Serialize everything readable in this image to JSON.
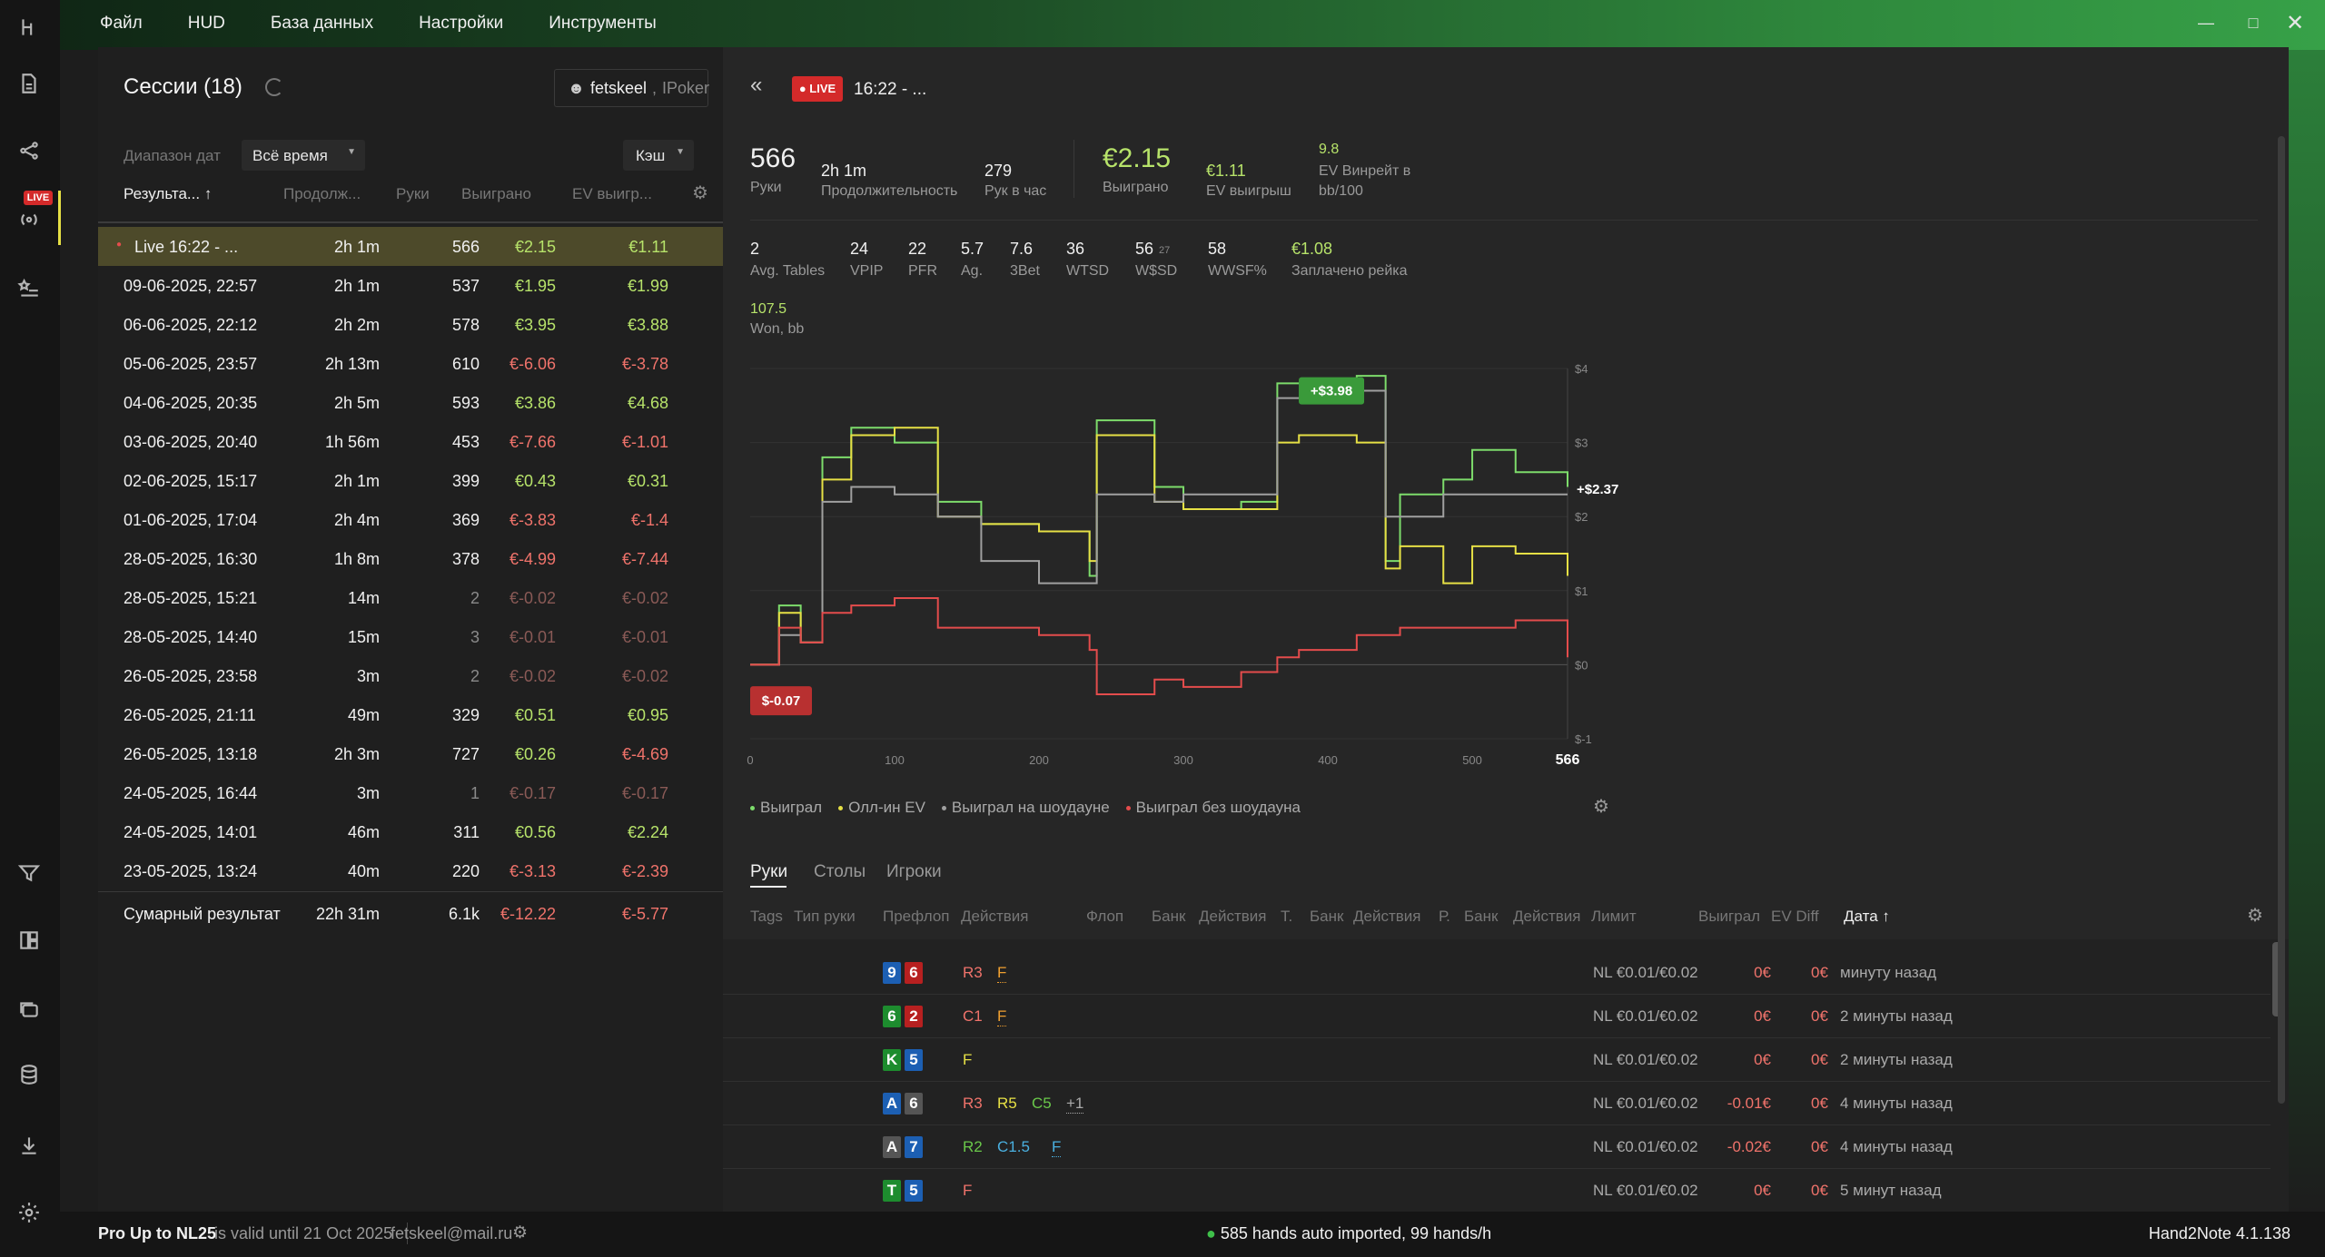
{
  "menu": {
    "file": "Файл",
    "hud": "HUD",
    "database": "База данных",
    "settings": "Настройки",
    "tools": "Инструменты"
  },
  "sidebar": {
    "live_badge": "LIVE"
  },
  "sessions": {
    "title": "Сессии (18)",
    "user": "fetskeel",
    "site": "IPoker",
    "date_range_label": "Диапазон дат",
    "date_range_value": "Всё время",
    "game_type": "Кэш",
    "headers": {
      "result": "Результа...",
      "duration": "Продолж...",
      "hands": "Руки",
      "won": "Выиграно",
      "ev": "EV выигр..."
    },
    "rows": [
      {
        "name": "Live 16:22 - ...",
        "dur": "2h 1m",
        "hands": "566",
        "won": "€2.15",
        "ev": "€1.11"
      },
      {
        "name": "09-06-2025, 22:57",
        "dur": "2h 1m",
        "hands": "537",
        "won": "€1.95",
        "ev": "€1.99"
      },
      {
        "name": "06-06-2025, 22:12",
        "dur": "2h 2m",
        "hands": "578",
        "won": "€3.95",
        "ev": "€3.88"
      },
      {
        "name": "05-06-2025, 23:57",
        "dur": "2h 13m",
        "hands": "610",
        "won": "€-6.06",
        "ev": "€-3.78"
      },
      {
        "name": "04-06-2025, 20:35",
        "dur": "2h 5m",
        "hands": "593",
        "won": "€3.86",
        "ev": "€4.68"
      },
      {
        "name": "03-06-2025, 20:40",
        "dur": "1h 56m",
        "hands": "453",
        "won": "€-7.66",
        "ev": "€-1.01"
      },
      {
        "name": "02-06-2025, 15:17",
        "dur": "2h 1m",
        "hands": "399",
        "won": "€0.43",
        "ev": "€0.31"
      },
      {
        "name": "01-06-2025, 17:04",
        "dur": "2h 4m",
        "hands": "369",
        "won": "€-3.83",
        "ev": "€-1.4"
      },
      {
        "name": "28-05-2025, 16:30",
        "dur": "1h 8m",
        "hands": "378",
        "won": "€-4.99",
        "ev": "€-7.44"
      },
      {
        "name": "28-05-2025, 15:21",
        "dur": "14m",
        "hands": "2",
        "won": "€-0.02",
        "ev": "€-0.02"
      },
      {
        "name": "28-05-2025, 14:40",
        "dur": "15m",
        "hands": "3",
        "won": "€-0.01",
        "ev": "€-0.01"
      },
      {
        "name": "26-05-2025, 23:58",
        "dur": "3m",
        "hands": "2",
        "won": "€-0.02",
        "ev": "€-0.02"
      },
      {
        "name": "26-05-2025, 21:11",
        "dur": "49m",
        "hands": "329",
        "won": "€0.51",
        "ev": "€0.95"
      },
      {
        "name": "26-05-2025, 13:18",
        "dur": "2h 3m",
        "hands": "727",
        "won": "€0.26",
        "ev": "€-4.69"
      },
      {
        "name": "24-05-2025, 16:44",
        "dur": "3m",
        "hands": "1",
        "won": "€-0.17",
        "ev": "€-0.17"
      },
      {
        "name": "24-05-2025, 14:01",
        "dur": "46m",
        "hands": "311",
        "won": "€0.56",
        "ev": "€2.24"
      },
      {
        "name": "23-05-2025, 13:24",
        "dur": "40m",
        "hands": "220",
        "won": "€-3.13",
        "ev": "€-2.39"
      }
    ],
    "total": {
      "name": "Сумарный результат",
      "dur": "22h 31m",
      "hands": "6.1k",
      "won": "€-12.22",
      "ev": "€-5.77"
    }
  },
  "session_detail": {
    "live": "LIVE",
    "time": "16:22 - ...",
    "hands": "566",
    "hands_label": "Руки",
    "duration": "2h 1m",
    "duration_label": "Продолжительность",
    "per_hour": "279",
    "per_hour_label": "Рук в час",
    "won": "€2.15",
    "won_label": "Выиграно",
    "ev_won": "€1.11",
    "ev_won_label": "EV выигрыш",
    "ev_winrate": "9.8",
    "ev_winrate_label1": "EV Винрейт в",
    "ev_winrate_label2": "bb/100",
    "stats": [
      {
        "v": "2",
        "l": "Avg. Tables"
      },
      {
        "v": "24",
        "l": "VPIP"
      },
      {
        "v": "22",
        "l": "PFR"
      },
      {
        "v": "5.7",
        "l": "Ag."
      },
      {
        "v": "7.6",
        "l": "3Bet"
      },
      {
        "v": "36",
        "l": "WTSD"
      },
      {
        "v": "56",
        "l": "W$SD",
        "sub": "27"
      },
      {
        "v": "58",
        "l": "WWSF%"
      },
      {
        "v": "€1.08",
        "l": "Заплачено рейка"
      }
    ],
    "won_bb": "107.5",
    "won_bb_label": "Won, bb"
  },
  "chart_data": {
    "type": "line",
    "xlim": [
      0,
      566
    ],
    "ylim": [
      -1,
      4
    ],
    "x_ticks": [
      "0",
      "100",
      "200",
      "300",
      "400",
      "500",
      "566"
    ],
    "y_ticks": [
      "$-1",
      "$0",
      "$1",
      "$2",
      "$3",
      "$4"
    ],
    "annotations": {
      "max": "+$3.98",
      "min": "$-0.07",
      "end": "+$2.37"
    },
    "x": [
      0,
      20,
      35,
      50,
      70,
      100,
      130,
      160,
      200,
      235,
      240,
      280,
      300,
      340,
      365,
      380,
      420,
      440,
      450,
      480,
      500,
      530,
      566
    ],
    "series": [
      {
        "name": "Выиграл",
        "color": "#7ddc6b",
        "values": [
          0,
          0.8,
          0.3,
          2.8,
          3.2,
          3.0,
          2.2,
          1.9,
          1.8,
          1.2,
          3.3,
          2.4,
          2.1,
          2.2,
          3.8,
          3.8,
          3.9,
          1.4,
          2.3,
          2.5,
          2.9,
          2.6,
          2.4
        ]
      },
      {
        "name": "Олл-ин EV",
        "color": "#e6e045",
        "values": [
          0,
          0.7,
          0.3,
          2.5,
          3.1,
          3.2,
          2.0,
          1.9,
          1.8,
          1.4,
          3.1,
          2.2,
          2.1,
          2.1,
          3.0,
          3.1,
          3.0,
          1.3,
          1.6,
          1.1,
          1.6,
          1.5,
          1.2
        ]
      },
      {
        "name": "Выиграл на шоудауне",
        "color": "#a0a0a0",
        "values": [
          0,
          0.4,
          0.3,
          2.2,
          2.4,
          2.3,
          2.0,
          1.4,
          1.1,
          1.1,
          2.3,
          2.2,
          2.3,
          2.3,
          3.6,
          3.6,
          3.7,
          2.0,
          2.0,
          2.3,
          2.3,
          2.3,
          2.3
        ]
      },
      {
        "name": "Выиграл без шоудауна",
        "color": "#e44c4c",
        "values": [
          0,
          0.5,
          0.3,
          0.7,
          0.8,
          0.9,
          0.5,
          0.5,
          0.4,
          0.2,
          -0.4,
          -0.2,
          -0.3,
          -0.1,
          0.1,
          0.2,
          0.4,
          0.4,
          0.5,
          0.5,
          0.5,
          0.6,
          0.1
        ]
      }
    ]
  },
  "hands_tabs": [
    "Руки",
    "Столы",
    "Игроки"
  ],
  "hands_headers": [
    "Tags",
    "Тип руки",
    "Префлоп",
    "Действия",
    "Флоп",
    "Банк",
    "Действия",
    "Т.",
    "Банк",
    "Действия",
    "Р.",
    "Банк",
    "Действия",
    "Лимит",
    "Выиграл",
    "EV Diff",
    "Дата ↑"
  ],
  "hands": [
    {
      "c1": "9",
      "c1c": "cb",
      "c2": "6",
      "c2c": "cr",
      "acts": [
        {
          "t": "R3",
          "c": "#f0736b"
        },
        {
          "t": "F",
          "c": "#f0a030",
          "u": true
        }
      ],
      "limit": "NL €0.01/€0.02",
      "won": "0€",
      "wc": "#f0736b",
      "ev": "0€",
      "date": "минуту назад"
    },
    {
      "c1": "6",
      "c1c": "cg",
      "c2": "2",
      "c2c": "cr",
      "acts": [
        {
          "t": "C1",
          "c": "#f0736b"
        },
        {
          "t": "F",
          "c": "#f0a030",
          "u": true
        }
      ],
      "limit": "NL €0.01/€0.02",
      "won": "0€",
      "wc": "#f0736b",
      "ev": "0€",
      "date": "2 минуты назад"
    },
    {
      "c1": "K",
      "c1c": "cg",
      "c2": "5",
      "c2c": "cb",
      "acts": [
        {
          "t": "F",
          "c": "#e6e045"
        }
      ],
      "limit": "NL €0.01/€0.02",
      "won": "0€",
      "wc": "#f0736b",
      "ev": "0€",
      "date": "2 минуты назад"
    },
    {
      "c1": "A",
      "c1c": "cb",
      "c2": "6",
      "c2c": "cgy",
      "acts": [
        {
          "t": "R3",
          "c": "#f0736b"
        },
        {
          "t": "R5",
          "c": "#e6e045"
        },
        {
          "t": "C5",
          "c": "#6ac84a"
        },
        {
          "t": "+1",
          "c": "#aaa",
          "u": true
        }
      ],
      "limit": "NL €0.01/€0.02",
      "won": "-0.01€",
      "wc": "#f0736b",
      "ev": "0€",
      "date": "4 минуты назад"
    },
    {
      "c1": "A",
      "c1c": "cgy",
      "c2": "7",
      "c2c": "cb",
      "acts": [
        {
          "t": "R2",
          "c": "#6ac84a"
        },
        {
          "t": "C1.5",
          "c": "#4ab0e0"
        },
        {
          "t": "F",
          "c": "#4ab0e0",
          "u": true
        }
      ],
      "limit": "NL €0.01/€0.02",
      "won": "-0.02€",
      "wc": "#f0736b",
      "ev": "0€",
      "date": "4 минуты назад"
    },
    {
      "c1": "T",
      "c1c": "cg",
      "c2": "5",
      "c2c": "cb",
      "acts": [
        {
          "t": "F",
          "c": "#f0736b"
        }
      ],
      "limit": "NL €0.01/€0.02",
      "won": "0€",
      "wc": "#f0736b",
      "ev": "0€",
      "date": "5 минут назад"
    }
  ],
  "status": {
    "license": "Pro Up to NL25",
    "valid": "is valid until 21 Oct 2025",
    "email": "fetskeel@mail.ru",
    "import": "585 hands auto imported, 99 hands/h",
    "version": "Hand2Note 4.1.138"
  }
}
